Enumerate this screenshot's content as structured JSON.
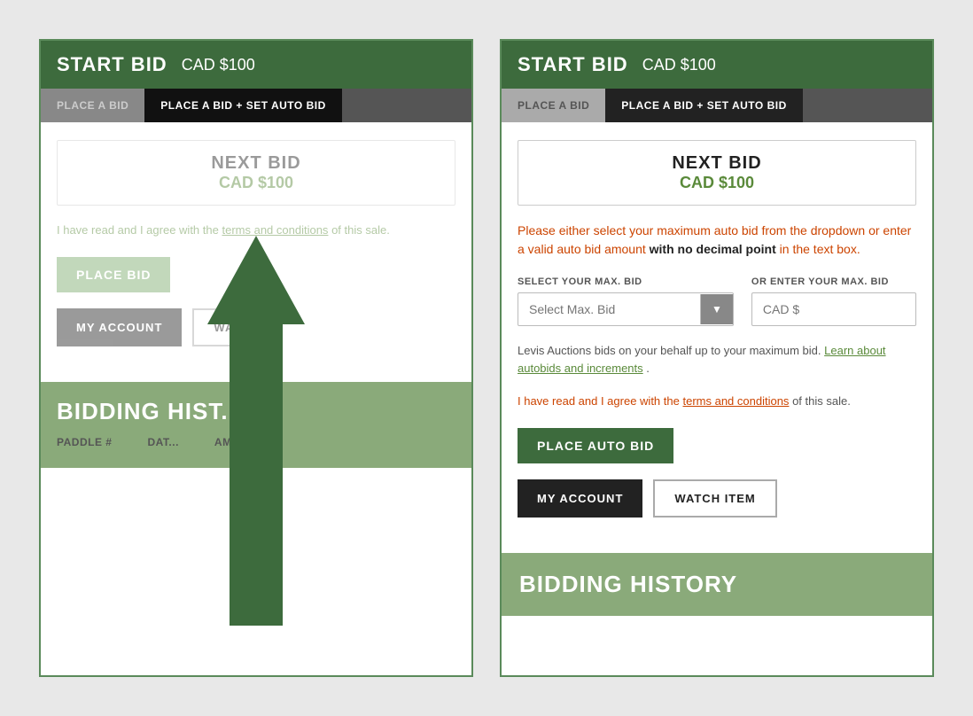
{
  "left_panel": {
    "start_bid_label": "START BID",
    "start_bid_amount": "CAD $100",
    "tab_place_bid": "PLACE A BID",
    "tab_auto_bid": "PLACE A BID + SET AUTO BID",
    "next_bid_title": "NEXT BID",
    "next_bid_amount": "CAD $100",
    "terms_text_1": "I have read and I agree with the",
    "terms_link": "terms and conditions",
    "terms_text_2": "of this sale.",
    "place_bid_btn": "PLACE BID",
    "my_account_btn": "MY ACCOUNT",
    "watch_btn": "WAT...",
    "bidding_history_title": "BIDDING HIST..."
  },
  "right_panel": {
    "start_bid_label": "START BID",
    "start_bid_amount": "CAD $100",
    "tab_place_bid": "PLACE A BID",
    "tab_auto_bid": "PLACE A BID + SET AUTO BID",
    "next_bid_title": "NEXT BID",
    "next_bid_amount": "CAD $100",
    "instructions_part1": "Please either select your maximum auto bid from the dropdown or enter a valid auto bid amount",
    "instructions_bold": "with no decimal point",
    "instructions_part2": "in the text box.",
    "select_label": "SELECT YOUR MAX. BID",
    "select_placeholder": "Select Max. Bid",
    "enter_label": "OR ENTER YOUR MAX. BID",
    "input_placeholder": "CAD $",
    "auto_bid_info": "Levis Auctions bids on your behalf up to your maximum bid.",
    "auto_bid_link": "Learn about autobids and increments",
    "auto_bid_end": ".",
    "terms_text_1": "I have read and I agree with the",
    "terms_link": "terms and conditions",
    "terms_text_2": "of this sale.",
    "place_auto_bid_btn": "PLACE AUTO BID",
    "my_account_btn": "MY ACCOUNT",
    "watch_btn": "WATCH ITEM",
    "bidding_history_title": "BIDDING HISTORY"
  }
}
